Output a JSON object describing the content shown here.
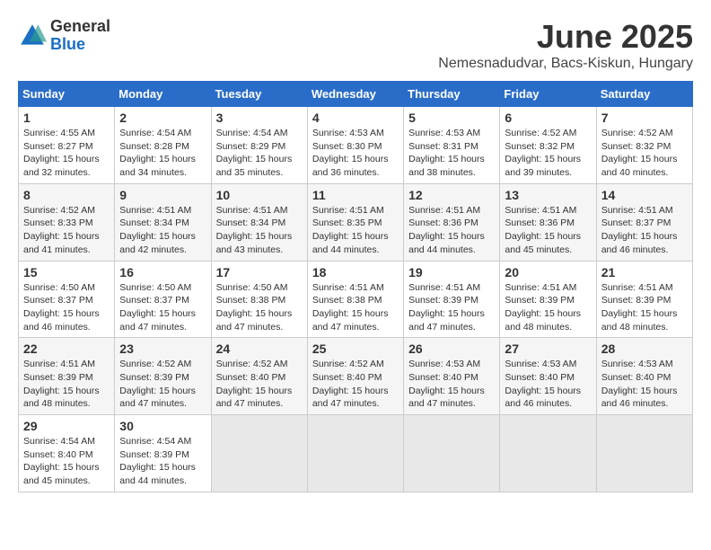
{
  "logo": {
    "general": "General",
    "blue": "Blue"
  },
  "title": "June 2025",
  "location": "Nemesnadudvar, Bacs-Kiskun, Hungary",
  "weekdays": [
    "Sunday",
    "Monday",
    "Tuesday",
    "Wednesday",
    "Thursday",
    "Friday",
    "Saturday"
  ],
  "weeks": [
    [
      {
        "day": "1",
        "sunrise": "4:55 AM",
        "sunset": "8:27 PM",
        "daylight": "15 hours and 32 minutes."
      },
      {
        "day": "2",
        "sunrise": "4:54 AM",
        "sunset": "8:28 PM",
        "daylight": "15 hours and 34 minutes."
      },
      {
        "day": "3",
        "sunrise": "4:54 AM",
        "sunset": "8:29 PM",
        "daylight": "15 hours and 35 minutes."
      },
      {
        "day": "4",
        "sunrise": "4:53 AM",
        "sunset": "8:30 PM",
        "daylight": "15 hours and 36 minutes."
      },
      {
        "day": "5",
        "sunrise": "4:53 AM",
        "sunset": "8:31 PM",
        "daylight": "15 hours and 38 minutes."
      },
      {
        "day": "6",
        "sunrise": "4:52 AM",
        "sunset": "8:32 PM",
        "daylight": "15 hours and 39 minutes."
      },
      {
        "day": "7",
        "sunrise": "4:52 AM",
        "sunset": "8:32 PM",
        "daylight": "15 hours and 40 minutes."
      }
    ],
    [
      {
        "day": "8",
        "sunrise": "4:52 AM",
        "sunset": "8:33 PM",
        "daylight": "15 hours and 41 minutes."
      },
      {
        "day": "9",
        "sunrise": "4:51 AM",
        "sunset": "8:34 PM",
        "daylight": "15 hours and 42 minutes."
      },
      {
        "day": "10",
        "sunrise": "4:51 AM",
        "sunset": "8:34 PM",
        "daylight": "15 hours and 43 minutes."
      },
      {
        "day": "11",
        "sunrise": "4:51 AM",
        "sunset": "8:35 PM",
        "daylight": "15 hours and 44 minutes."
      },
      {
        "day": "12",
        "sunrise": "4:51 AM",
        "sunset": "8:36 PM",
        "daylight": "15 hours and 44 minutes."
      },
      {
        "day": "13",
        "sunrise": "4:51 AM",
        "sunset": "8:36 PM",
        "daylight": "15 hours and 45 minutes."
      },
      {
        "day": "14",
        "sunrise": "4:51 AM",
        "sunset": "8:37 PM",
        "daylight": "15 hours and 46 minutes."
      }
    ],
    [
      {
        "day": "15",
        "sunrise": "4:50 AM",
        "sunset": "8:37 PM",
        "daylight": "15 hours and 46 minutes."
      },
      {
        "day": "16",
        "sunrise": "4:50 AM",
        "sunset": "8:37 PM",
        "daylight": "15 hours and 47 minutes."
      },
      {
        "day": "17",
        "sunrise": "4:50 AM",
        "sunset": "8:38 PM",
        "daylight": "15 hours and 47 minutes."
      },
      {
        "day": "18",
        "sunrise": "4:51 AM",
        "sunset": "8:38 PM",
        "daylight": "15 hours and 47 minutes."
      },
      {
        "day": "19",
        "sunrise": "4:51 AM",
        "sunset": "8:39 PM",
        "daylight": "15 hours and 47 minutes."
      },
      {
        "day": "20",
        "sunrise": "4:51 AM",
        "sunset": "8:39 PM",
        "daylight": "15 hours and 48 minutes."
      },
      {
        "day": "21",
        "sunrise": "4:51 AM",
        "sunset": "8:39 PM",
        "daylight": "15 hours and 48 minutes."
      }
    ],
    [
      {
        "day": "22",
        "sunrise": "4:51 AM",
        "sunset": "8:39 PM",
        "daylight": "15 hours and 48 minutes."
      },
      {
        "day": "23",
        "sunrise": "4:52 AM",
        "sunset": "8:39 PM",
        "daylight": "15 hours and 47 minutes."
      },
      {
        "day": "24",
        "sunrise": "4:52 AM",
        "sunset": "8:40 PM",
        "daylight": "15 hours and 47 minutes."
      },
      {
        "day": "25",
        "sunrise": "4:52 AM",
        "sunset": "8:40 PM",
        "daylight": "15 hours and 47 minutes."
      },
      {
        "day": "26",
        "sunrise": "4:53 AM",
        "sunset": "8:40 PM",
        "daylight": "15 hours and 47 minutes."
      },
      {
        "day": "27",
        "sunrise": "4:53 AM",
        "sunset": "8:40 PM",
        "daylight": "15 hours and 46 minutes."
      },
      {
        "day": "28",
        "sunrise": "4:53 AM",
        "sunset": "8:40 PM",
        "daylight": "15 hours and 46 minutes."
      }
    ],
    [
      {
        "day": "29",
        "sunrise": "4:54 AM",
        "sunset": "8:40 PM",
        "daylight": "15 hours and 45 minutes."
      },
      {
        "day": "30",
        "sunrise": "4:54 AM",
        "sunset": "8:39 PM",
        "daylight": "15 hours and 44 minutes."
      },
      null,
      null,
      null,
      null,
      null
    ]
  ]
}
